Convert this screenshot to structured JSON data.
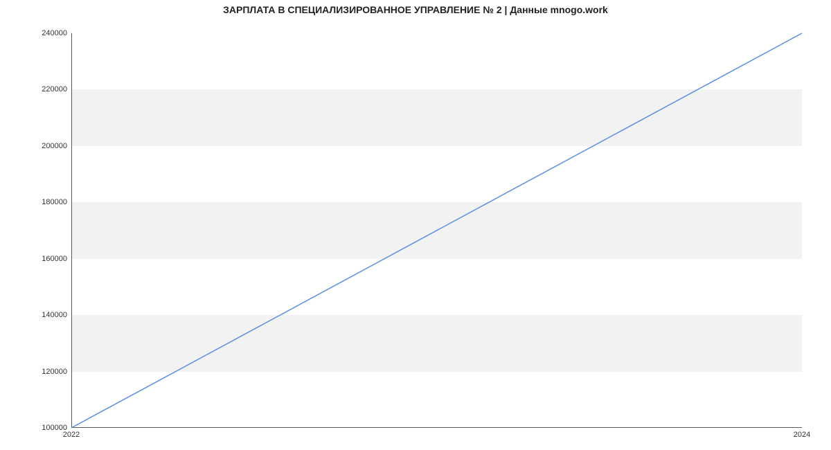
{
  "chart_data": {
    "type": "line",
    "title": "ЗАРПЛАТА В  СПЕЦИАЛИЗИРОВАННОЕ УПРАВЛЕНИЕ № 2 | Данные mnogo.work",
    "x": [
      2022,
      2024
    ],
    "values": [
      100000,
      240000
    ],
    "xlabel": "",
    "ylabel": "",
    "x_ticks": [
      2022,
      2024
    ],
    "y_ticks": [
      100000,
      120000,
      140000,
      160000,
      180000,
      200000,
      220000,
      240000
    ],
    "xlim": [
      2022,
      2024
    ],
    "ylim": [
      100000,
      240000
    ],
    "line_color": "#5a8ee6",
    "band_color": "#f2f2f2"
  }
}
